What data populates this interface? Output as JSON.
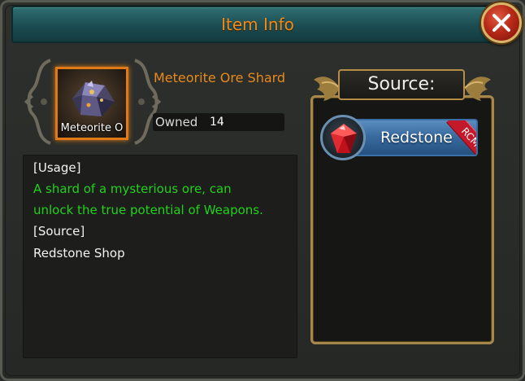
{
  "window": {
    "title": "Item Info",
    "close_icon": "close-x-icon"
  },
  "item": {
    "name": "Meteorite Ore Shard",
    "slot_label": "Meteorite O",
    "icon": "meteorite-ore-shard-icon",
    "owned_label": "Owned",
    "owned_value": "14"
  },
  "description": {
    "usage_header": "[Usage]",
    "usage_line1": "A shard of a mysterious ore, can",
    "usage_line2": "unlock the true potential of Weapons.",
    "source_header": "[Source]",
    "source_text": "Redstone Shop"
  },
  "source": {
    "title": "Source:",
    "entries": [
      {
        "label": "Redstone",
        "badge": "RCMD",
        "icon": "red-gem-icon"
      }
    ]
  },
  "colors": {
    "title_orange": "#f08a1a",
    "usage_green": "#22d01c",
    "badge_red": "#c4192a",
    "button_blue": "#3a6ba0"
  }
}
